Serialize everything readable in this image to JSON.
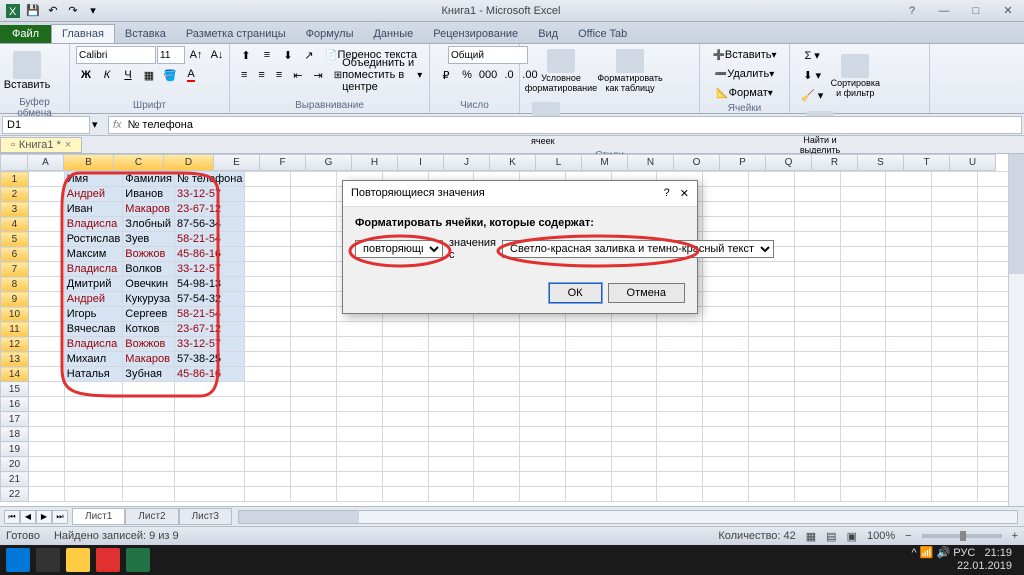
{
  "title": "Книга1 - Microsoft Excel",
  "tabs": {
    "file": "Файл",
    "home": "Главная",
    "insert": "Вставка",
    "pagelayout": "Разметка страницы",
    "formulas": "Формулы",
    "data": "Данные",
    "review": "Рецензирование",
    "view": "Вид",
    "officetab": "Office Tab"
  },
  "ribbon": {
    "clipboard": {
      "paste": "Вставить",
      "label": "Буфер обмена"
    },
    "font": {
      "name": "Calibri",
      "size": "11",
      "label": "Шрифт"
    },
    "align": {
      "wrap": "Перенос текста",
      "merge": "Объединить и поместить в центре",
      "label": "Выравнивание"
    },
    "number": {
      "format": "Общий",
      "label": "Число"
    },
    "styles": {
      "cond": "Условное форматирование",
      "table": "Форматировать как таблицу",
      "cell": "Стили ячеек",
      "label": "Стили"
    },
    "cells": {
      "insert": "Вставить",
      "delete": "Удалить",
      "format": "Формат",
      "label": "Ячейки"
    },
    "editing": {
      "sort": "Сортировка и фильтр",
      "find": "Найти и выделить",
      "label": "Редактирование"
    }
  },
  "name_box": "D1",
  "formula_value": "№ телефона",
  "workbook_tab": "Книга1 *",
  "columns": [
    "A",
    "B",
    "C",
    "D",
    "E",
    "F",
    "G",
    "H",
    "I",
    "J",
    "K",
    "L",
    "M",
    "N",
    "O",
    "P",
    "Q",
    "R",
    "S",
    "T",
    "U"
  ],
  "headers_row": {
    "b": "Имя",
    "c": "Фамилия",
    "d": "№ телефона"
  },
  "data_rows": [
    {
      "b": "Андрей",
      "b_dup": true,
      "c": "Иванов",
      "c_dup": false,
      "d": "33-12-57",
      "d_dup": true
    },
    {
      "b": "Иван",
      "b_dup": false,
      "c": "Макаров",
      "c_dup": true,
      "d": "23-67-12",
      "d_dup": true
    },
    {
      "b": "Владисла",
      "b_dup": true,
      "c": "Злобный",
      "c_dup": false,
      "d": "87-56-34",
      "d_dup": false
    },
    {
      "b": "Ростислав",
      "b_dup": false,
      "c": "Зуев",
      "c_dup": false,
      "d": "58-21-54",
      "d_dup": true
    },
    {
      "b": "Максим",
      "b_dup": false,
      "c": "Вожжов",
      "c_dup": true,
      "d": "45-86-16",
      "d_dup": true
    },
    {
      "b": "Владисла",
      "b_dup": true,
      "c": "Волков",
      "c_dup": false,
      "d": "33-12-57",
      "d_dup": true
    },
    {
      "b": "Дмитрий",
      "b_dup": false,
      "c": "Овечкин",
      "c_dup": false,
      "d": "54-98-13",
      "d_dup": false
    },
    {
      "b": "Андрей",
      "b_dup": true,
      "c": "Кукуруза",
      "c_dup": false,
      "d": "57-54-32",
      "d_dup": false
    },
    {
      "b": "Игорь",
      "b_dup": false,
      "c": "Сергеев",
      "c_dup": false,
      "d": "58-21-54",
      "d_dup": true
    },
    {
      "b": "Вячеслав",
      "b_dup": false,
      "c": "Котков",
      "c_dup": false,
      "d": "23-67-12",
      "d_dup": true
    },
    {
      "b": "Владисла",
      "b_dup": true,
      "c": "Вожжов",
      "c_dup": true,
      "d": "33-12-57",
      "d_dup": true
    },
    {
      "b": "Михаил",
      "b_dup": false,
      "c": "Макаров",
      "c_dup": true,
      "d": "57-38-25",
      "d_dup": false
    },
    {
      "b": "Наталья",
      "b_dup": false,
      "c": "Зубная",
      "c_dup": false,
      "d": "45-86-16",
      "d_dup": true
    }
  ],
  "dialog": {
    "title": "Повторяющиеся значения",
    "label": "Форматировать ячейки, которые содержат:",
    "select1_text": "повторяющиеся",
    "between": "значения с",
    "select2_text": "Светло-красная заливка и темно-красный текст",
    "ok": "ОК",
    "cancel": "Отмена"
  },
  "sheet_tabs": [
    "Лист1",
    "Лист2",
    "Лист3"
  ],
  "status": {
    "ready": "Готово",
    "found": "Найдено записей: 9 из 9",
    "count": "Количество: 42",
    "zoom": "100%"
  },
  "taskbar": {
    "time": "21:19",
    "date": "22.01.2019",
    "lang": "РУС"
  }
}
